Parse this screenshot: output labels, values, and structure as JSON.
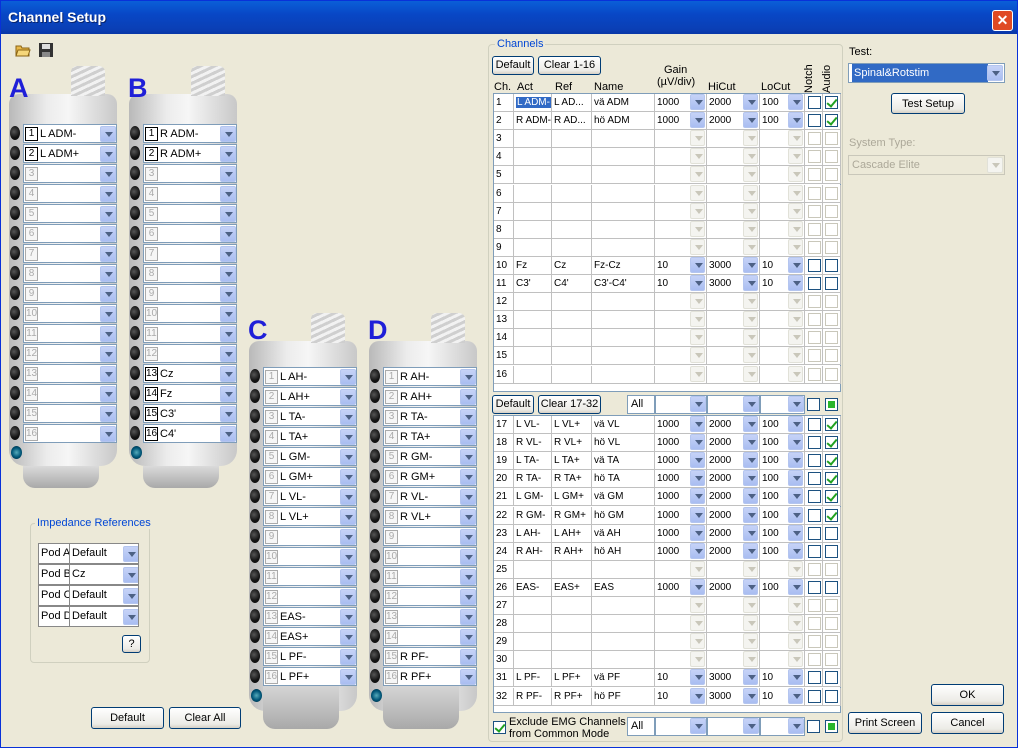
{
  "window": {
    "title": "Channel Setup",
    "close": "✕"
  },
  "toolbar": {
    "open_icon": "folder-open-icon",
    "save_icon": "save-disk-icon"
  },
  "pods": [
    {
      "label": "A",
      "channels": [
        {
          "n": "1",
          "v": "L ADM-",
          "on": true
        },
        {
          "n": "2",
          "v": "L ADM+",
          "on": true
        },
        {
          "n": "3",
          "v": ""
        },
        {
          "n": "4",
          "v": ""
        },
        {
          "n": "5",
          "v": ""
        },
        {
          "n": "6",
          "v": ""
        },
        {
          "n": "7",
          "v": ""
        },
        {
          "n": "8",
          "v": ""
        },
        {
          "n": "9",
          "v": ""
        },
        {
          "n": "10",
          "v": ""
        },
        {
          "n": "11",
          "v": ""
        },
        {
          "n": "12",
          "v": ""
        },
        {
          "n": "13",
          "v": ""
        },
        {
          "n": "14",
          "v": ""
        },
        {
          "n": "15",
          "v": ""
        },
        {
          "n": "16",
          "v": ""
        }
      ]
    },
    {
      "label": "B",
      "channels": [
        {
          "n": "1",
          "v": "R ADM-",
          "on": true
        },
        {
          "n": "2",
          "v": "R ADM+",
          "on": true
        },
        {
          "n": "3",
          "v": ""
        },
        {
          "n": "4",
          "v": ""
        },
        {
          "n": "5",
          "v": ""
        },
        {
          "n": "6",
          "v": ""
        },
        {
          "n": "7",
          "v": ""
        },
        {
          "n": "8",
          "v": ""
        },
        {
          "n": "9",
          "v": ""
        },
        {
          "n": "10",
          "v": ""
        },
        {
          "n": "11",
          "v": ""
        },
        {
          "n": "12",
          "v": ""
        },
        {
          "n": "13",
          "v": "Cz",
          "on": true
        },
        {
          "n": "14",
          "v": "Fz",
          "on": true
        },
        {
          "n": "15",
          "v": "C3'",
          "on": true
        },
        {
          "n": "16",
          "v": "C4'",
          "on": true
        }
      ]
    },
    {
      "label": "C",
      "channels": [
        {
          "n": "1",
          "v": "L AH-"
        },
        {
          "n": "2",
          "v": "L AH+"
        },
        {
          "n": "3",
          "v": "L TA-"
        },
        {
          "n": "4",
          "v": "L TA+"
        },
        {
          "n": "5",
          "v": "L GM-"
        },
        {
          "n": "6",
          "v": "L GM+"
        },
        {
          "n": "7",
          "v": "L VL-"
        },
        {
          "n": "8",
          "v": "L VL+"
        },
        {
          "n": "9",
          "v": ""
        },
        {
          "n": "10",
          "v": ""
        },
        {
          "n": "11",
          "v": ""
        },
        {
          "n": "12",
          "v": ""
        },
        {
          "n": "13",
          "v": "EAS-"
        },
        {
          "n": "14",
          "v": "EAS+"
        },
        {
          "n": "15",
          "v": "L PF-"
        },
        {
          "n": "16",
          "v": "L PF+"
        }
      ]
    },
    {
      "label": "D",
      "channels": [
        {
          "n": "1",
          "v": "R AH-"
        },
        {
          "n": "2",
          "v": "R AH+"
        },
        {
          "n": "3",
          "v": "R TA-"
        },
        {
          "n": "4",
          "v": "R TA+"
        },
        {
          "n": "5",
          "v": "R GM-"
        },
        {
          "n": "6",
          "v": "R GM+"
        },
        {
          "n": "7",
          "v": "R VL-"
        },
        {
          "n": "8",
          "v": "R VL+"
        },
        {
          "n": "9",
          "v": ""
        },
        {
          "n": "10",
          "v": ""
        },
        {
          "n": "11",
          "v": ""
        },
        {
          "n": "12",
          "v": ""
        },
        {
          "n": "13",
          "v": ""
        },
        {
          "n": "14",
          "v": ""
        },
        {
          "n": "15",
          "v": "R PF-"
        },
        {
          "n": "16",
          "v": "R PF+"
        }
      ]
    }
  ],
  "impedance": {
    "title": "Impedance References",
    "rows": [
      {
        "pod": "Pod A",
        "ref": "Default"
      },
      {
        "pod": "Pod B",
        "ref": "Cz"
      },
      {
        "pod": "Pod C",
        "ref": "Default"
      },
      {
        "pod": "Pod D",
        "ref": "Default"
      }
    ],
    "help": "?"
  },
  "left_buttons": {
    "default": "Default",
    "clear_all": "Clear All"
  },
  "channels": {
    "title": "Channels",
    "default_btn": "Default",
    "clear1": "Clear 1-16",
    "default_btn2": "Default",
    "clear2": "Clear 17-32",
    "headers": {
      "ch": "Ch.",
      "act": "Act",
      "ref": "Ref",
      "name": "Name",
      "gain": "Gain",
      "gain_unit": "(µV/div)",
      "hicut": "HiCut",
      "locut": "LoCut",
      "notch": "Notch",
      "audio": "Audio"
    },
    "all_label": "All",
    "all_label2": "All",
    "exclude_label": "Exclude EMG Channels from Common Mode",
    "rows1": [
      {
        "ch": "1",
        "act": "L ADM-",
        "ref": "L AD...",
        "name": "vä ADM",
        "gain": "1000",
        "hi": "2000",
        "lo": "100",
        "audio": true,
        "sel": true
      },
      {
        "ch": "2",
        "act": "R ADM-",
        "ref": "R AD...",
        "name": "hö ADM",
        "gain": "1000",
        "hi": "2000",
        "lo": "100",
        "audio": true
      },
      {
        "ch": "3"
      },
      {
        "ch": "4"
      },
      {
        "ch": "5"
      },
      {
        "ch": "6"
      },
      {
        "ch": "7"
      },
      {
        "ch": "8"
      },
      {
        "ch": "9"
      },
      {
        "ch": "10",
        "act": "Fz",
        "ref": "Cz",
        "name": "Fz-Cz",
        "gain": "10",
        "hi": "3000",
        "lo": "10"
      },
      {
        "ch": "11",
        "act": "C3'",
        "ref": "C4'",
        "name": "C3'-C4'",
        "gain": "10",
        "hi": "3000",
        "lo": "10"
      },
      {
        "ch": "12"
      },
      {
        "ch": "13"
      },
      {
        "ch": "14"
      },
      {
        "ch": "15"
      },
      {
        "ch": "16"
      }
    ],
    "rows2": [
      {
        "ch": "17",
        "act": "L VL-",
        "ref": "L VL+",
        "name": "vä VL",
        "gain": "1000",
        "hi": "2000",
        "lo": "100",
        "audio": true
      },
      {
        "ch": "18",
        "act": "R VL-",
        "ref": "R VL+",
        "name": "hö VL",
        "gain": "1000",
        "hi": "2000",
        "lo": "100",
        "audio": true
      },
      {
        "ch": "19",
        "act": "L TA-",
        "ref": "L TA+",
        "name": "vä TA",
        "gain": "1000",
        "hi": "2000",
        "lo": "100",
        "audio": true
      },
      {
        "ch": "20",
        "act": "R TA-",
        "ref": "R TA+",
        "name": "hö TA",
        "gain": "1000",
        "hi": "2000",
        "lo": "100",
        "audio": true
      },
      {
        "ch": "21",
        "act": "L GM-",
        "ref": "L GM+",
        "name": "vä GM",
        "gain": "1000",
        "hi": "2000",
        "lo": "100",
        "audio": true
      },
      {
        "ch": "22",
        "act": "R GM-",
        "ref": "R GM+",
        "name": "hö GM",
        "gain": "1000",
        "hi": "2000",
        "lo": "100",
        "audio": true
      },
      {
        "ch": "23",
        "act": "L AH-",
        "ref": "L AH+",
        "name": "vä AH",
        "gain": "1000",
        "hi": "2000",
        "lo": "100"
      },
      {
        "ch": "24",
        "act": "R AH-",
        "ref": "R AH+",
        "name": "hö AH",
        "gain": "1000",
        "hi": "2000",
        "lo": "100"
      },
      {
        "ch": "25"
      },
      {
        "ch": "26",
        "act": "EAS-",
        "ref": "EAS+",
        "name": "EAS",
        "gain": "1000",
        "hi": "2000",
        "lo": "100"
      },
      {
        "ch": "27"
      },
      {
        "ch": "28"
      },
      {
        "ch": "29"
      },
      {
        "ch": "30"
      },
      {
        "ch": "31",
        "act": "L PF-",
        "ref": "L PF+",
        "name": "vä PF",
        "gain": "10",
        "hi": "3000",
        "lo": "10"
      },
      {
        "ch": "32",
        "act": "R PF-",
        "ref": "R PF+",
        "name": "hö PF",
        "gain": "10",
        "hi": "3000",
        "lo": "10"
      }
    ]
  },
  "right": {
    "test_label": "Test:",
    "test_value": "Spinal&Rotstim",
    "test_setup": "Test Setup",
    "system_label": "System Type:",
    "system_value": "Cascade Elite",
    "ok": "OK",
    "print": "Print Screen",
    "cancel": "Cancel"
  }
}
